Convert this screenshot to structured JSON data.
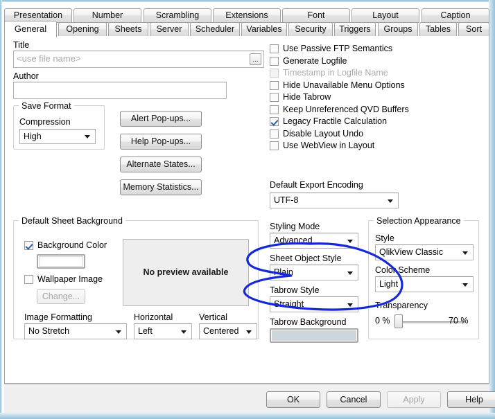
{
  "window": {
    "accent_color": "#8fc0da",
    "panel_background": "#ffffff"
  },
  "tabs": {
    "row_top": [
      {
        "label": "Presentation"
      },
      {
        "label": "Number"
      },
      {
        "label": "Scrambling"
      },
      {
        "label": "Extensions"
      },
      {
        "label": "Font"
      },
      {
        "label": "Layout"
      },
      {
        "label": "Caption"
      }
    ],
    "row_bottom": [
      {
        "label": "General",
        "active": true
      },
      {
        "label": "Opening"
      },
      {
        "label": "Sheets"
      },
      {
        "label": "Server"
      },
      {
        "label": "Scheduler"
      },
      {
        "label": "Variables"
      },
      {
        "label": "Security"
      },
      {
        "label": "Triggers"
      },
      {
        "label": "Groups"
      },
      {
        "label": "Tables"
      },
      {
        "label": "Sort"
      }
    ]
  },
  "general": {
    "title_label": "Title",
    "title_value": "",
    "title_placeholder": "<use file name>",
    "browse_button": "...",
    "author_label": "Author",
    "author_value": "",
    "save_format": {
      "group_title": "Save Format",
      "compression_label": "Compression",
      "compression_value": "High"
    },
    "buttons": [
      {
        "label": "Alert Pop-ups..."
      },
      {
        "label": "Help Pop-ups..."
      },
      {
        "label": "Alternate States..."
      },
      {
        "label": "Memory Statistics..."
      }
    ],
    "checkboxes": [
      {
        "label": "Use Passive FTP Semantics",
        "checked": false,
        "disabled": false
      },
      {
        "label": "Generate Logfile",
        "checked": false,
        "disabled": false
      },
      {
        "label": "Timestamp in Logfile Name",
        "checked": false,
        "disabled": true
      },
      {
        "label": "Hide Unavailable Menu Options",
        "checked": false,
        "disabled": false
      },
      {
        "label": "Hide Tabrow",
        "checked": false,
        "disabled": false
      },
      {
        "label": "Keep Unreferenced QVD Buffers",
        "checked": false,
        "disabled": false
      },
      {
        "label": "Legacy Fractile Calculation",
        "checked": true,
        "disabled": false
      },
      {
        "label": "Disable Layout Undo",
        "checked": false,
        "disabled": false
      },
      {
        "label": "Use WebView in Layout",
        "checked": false,
        "disabled": false
      }
    ],
    "export_encoding_label": "Default Export Encoding",
    "export_encoding_value": "UTF-8"
  },
  "sheet_background": {
    "group_title": "Default Sheet Background",
    "background_color_label": "Background Color",
    "background_color_checked": true,
    "background_color_swatch": "#ffffff",
    "wallpaper_image_label": "Wallpaper Image",
    "wallpaper_image_checked": false,
    "change_button": "Change...",
    "change_button_disabled": true,
    "preview_text": "No preview available",
    "image_formatting_label": "Image Formatting",
    "image_formatting_value": "No Stretch",
    "horizontal_label": "Horizontal",
    "horizontal_value": "Left",
    "vertical_label": "Vertical",
    "vertical_value": "Centered"
  },
  "styling": {
    "styling_mode_label": "Styling Mode",
    "styling_mode_value": "Advanced",
    "sheet_object_style_label": "Sheet Object Style",
    "sheet_object_style_value": "Plain",
    "tabrow_style_label": "Tabrow Style",
    "tabrow_style_value": "Straight",
    "tabrow_background_label": "Tabrow Background",
    "tabrow_background_swatch": "#ccd7dd"
  },
  "selection_appearance": {
    "group_title": "Selection Appearance",
    "style_label": "Style",
    "style_value": "QlikView Classic",
    "color_scheme_label": "Color Scheme",
    "color_scheme_value": "Light",
    "transparency_label": "Transparency",
    "transparency_min": "0 %",
    "transparency_max": "70 %"
  },
  "footer": {
    "ok": "OK",
    "cancel": "Cancel",
    "apply": "Apply",
    "apply_disabled": true,
    "help": "Help"
  },
  "annotation": {
    "type": "hand-drawn-ellipse",
    "color": "#1528d8"
  }
}
